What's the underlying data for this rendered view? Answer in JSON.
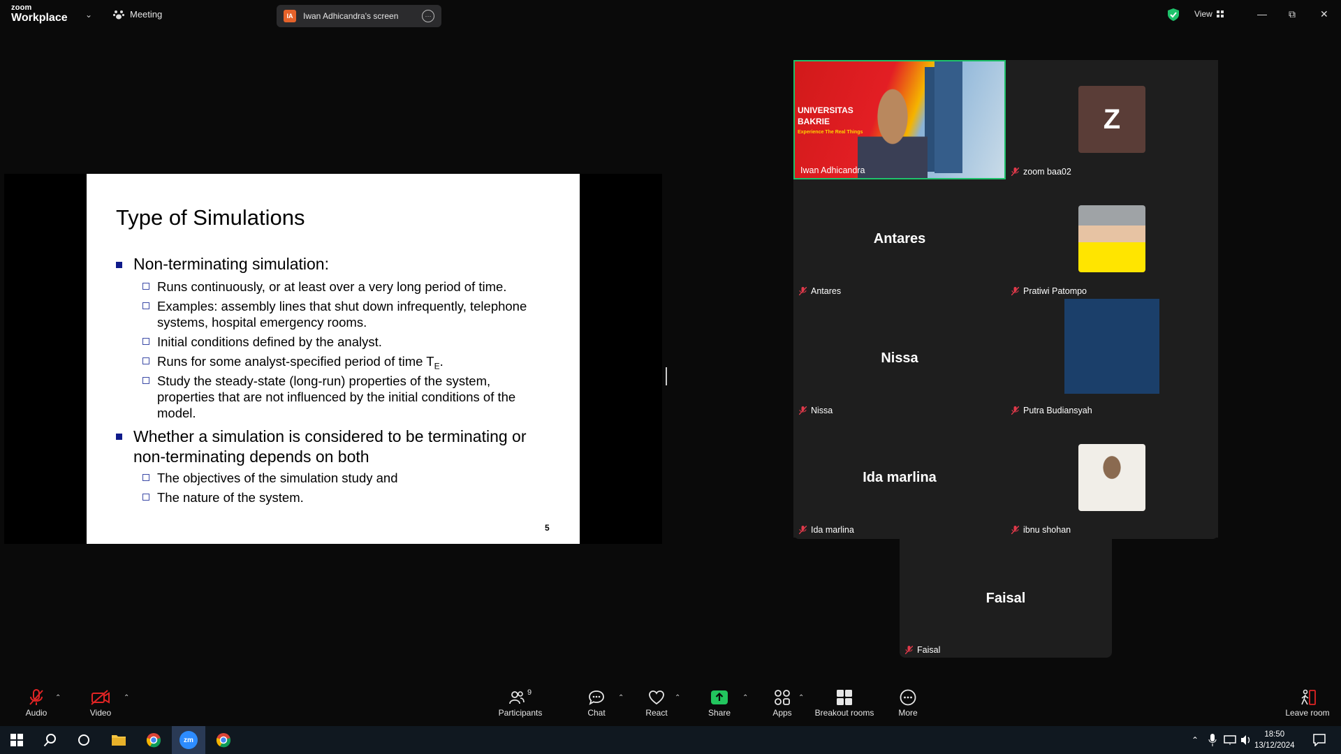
{
  "app": {
    "brand_top": "zoom",
    "brand_bottom": "Workplace",
    "meeting_label": "Meeting"
  },
  "share_tab": {
    "initials": "IA",
    "title": "Iwan Adhicandra's screen"
  },
  "topright": {
    "view_label": "View"
  },
  "slide": {
    "title": "Type of Simulations",
    "bullets": [
      "Non-terminating simulation:",
      "Whether a simulation is considered to be terminating or non-terminating depends on both"
    ],
    "sub1": [
      "Runs continuously, or at least over a very long period of time.",
      "Examples: assembly lines that shut down infrequently, telephone systems, hospital emergency rooms.",
      "Initial conditions defined by the analyst.",
      "Runs for some analyst-specified period of time T",
      "Study the steady-state (long-run) properties of the system, properties that are not influenced by the initial conditions of the model."
    ],
    "te_sub": "E",
    "te_after": ".",
    "sub2": [
      "The objectives of the simulation study and",
      "The nature of the system."
    ],
    "page": "5"
  },
  "participants": [
    {
      "name": "Iwan Adhicandra",
      "center": "",
      "banner1": "UNIVERSITAS",
      "banner2": "BAKRIE",
      "banner3": "Experience The Real Things"
    },
    {
      "name": "zoom baa02",
      "center": "",
      "avatar_letter": "Z"
    },
    {
      "name": "Antares",
      "center": "Antares"
    },
    {
      "name": "Pratiwi Patompo",
      "center": ""
    },
    {
      "name": "Nissa",
      "center": "Nissa"
    },
    {
      "name": "Putra Budiansyah",
      "center": ""
    },
    {
      "name": "Ida marlina",
      "center": "Ida marlina"
    },
    {
      "name": "ibnu shohan",
      "center": ""
    },
    {
      "name": "Faisal",
      "center": "Faisal"
    }
  ],
  "toolbar": {
    "audio": "Audio",
    "video": "Video",
    "participants": "Participants",
    "participants_count": "9",
    "chat": "Chat",
    "react": "React",
    "share": "Share",
    "apps": "Apps",
    "breakout": "Breakout rooms",
    "more": "More",
    "leave": "Leave room"
  },
  "taskbar": {
    "time": "18:50",
    "date": "13/12/2024"
  },
  "colors": {
    "accent_green": "#1ec26b",
    "share_green": "#22c55e",
    "leave_red": "#e02424",
    "muted_red": "#e0394a"
  }
}
